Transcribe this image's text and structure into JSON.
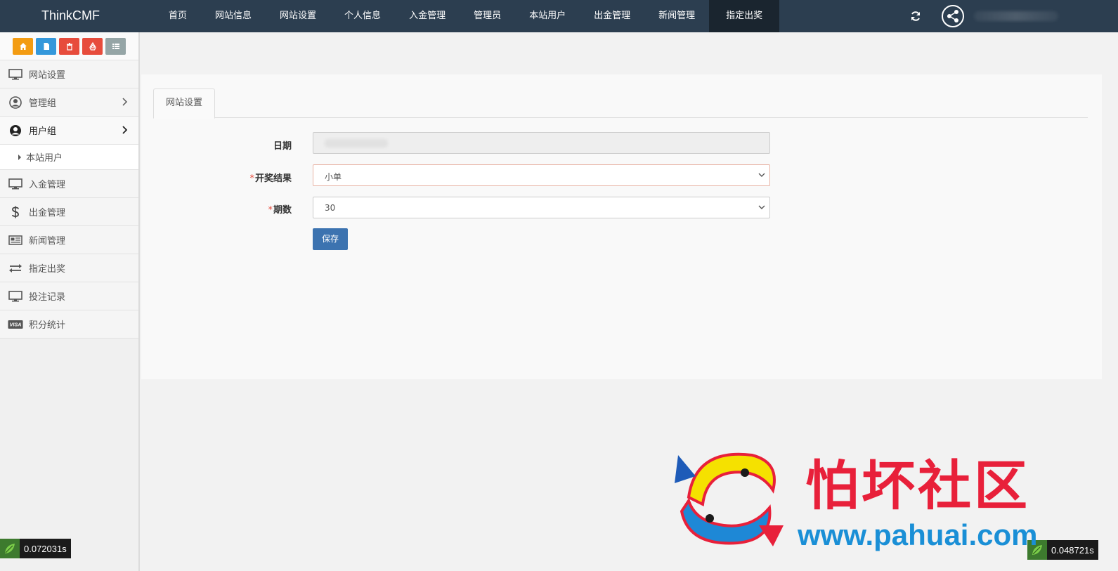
{
  "app": {
    "brand": "ThinkCMF"
  },
  "topnav": {
    "items": [
      "首页",
      "网站信息",
      "网站设置",
      "个人信息",
      "入金管理",
      "管理员",
      "本站用户",
      "出金管理",
      "新闻管理",
      "指定出奖"
    ],
    "active": "指定出奖"
  },
  "sidebar": {
    "shortcuts": [
      {
        "icon": "home-icon",
        "color": "#f39c12"
      },
      {
        "icon": "file-icon",
        "color": "#3498db"
      },
      {
        "icon": "trash-icon",
        "color": "#e74c3c"
      },
      {
        "icon": "recycle-icon",
        "color": "#e74c3c"
      },
      {
        "icon": "list-icon",
        "color": "#95a5a6"
      }
    ],
    "items": [
      {
        "label": "网站设置",
        "icon": "monitor-icon"
      },
      {
        "label": "管理组",
        "icon": "user-circle-icon",
        "has_children": true
      },
      {
        "label": "用户组",
        "icon": "user-circle-icon",
        "has_children": true,
        "open": true,
        "children": [
          "本站用户"
        ]
      },
      {
        "label": "入金管理",
        "icon": "monitor-icon"
      },
      {
        "label": "出金管理",
        "icon": "dollar-icon"
      },
      {
        "label": "新闻管理",
        "icon": "newspaper-icon"
      },
      {
        "label": "指定出奖",
        "icon": "exchange-icon"
      },
      {
        "label": "投注记录",
        "icon": "monitor-icon"
      },
      {
        "label": "积分统计",
        "icon": "visa-icon"
      }
    ]
  },
  "tab": {
    "label": "网站设置"
  },
  "form": {
    "date": {
      "label": "日期",
      "value": ""
    },
    "result": {
      "label": "开奖结果",
      "required_mark": "*",
      "value": "小单"
    },
    "period": {
      "label": "期数",
      "required_mark": "*",
      "value": "30"
    },
    "save_label": "保存"
  },
  "timing": {
    "left": "0.072031s",
    "right": "0.048721s"
  },
  "watermark": {
    "title": "怕坏社区",
    "url": "www.pahuai.com"
  },
  "colors": {
    "navbar": "#2c3e50",
    "primary_button": "#3c73b0",
    "required": "#e74c3c",
    "watermark_red": "#e8203a",
    "watermark_blue": "#1a8fd6"
  }
}
